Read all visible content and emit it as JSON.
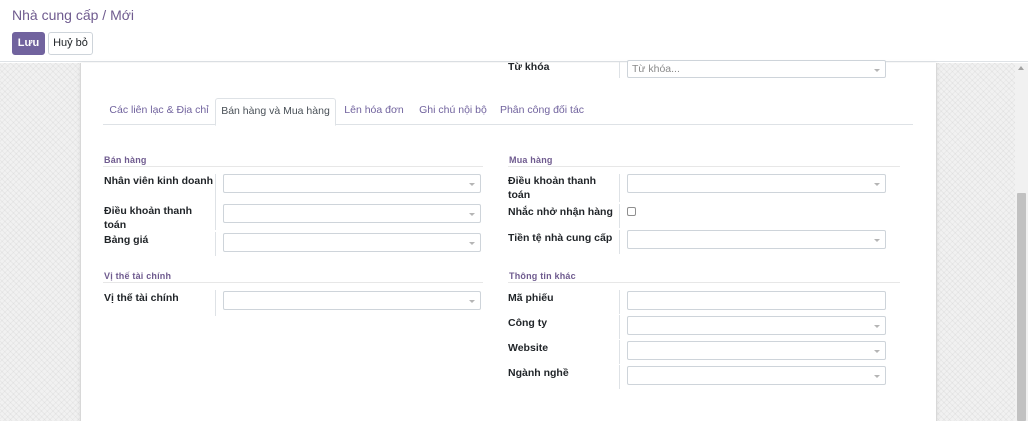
{
  "breadcrumb": {
    "parent": "Nhà cung cấp",
    "separator": " / ",
    "current": "Mới"
  },
  "actions": {
    "save_label": "Lưu",
    "discard_label": "Huỷ bỏ"
  },
  "top_field": {
    "label": "Từ khóa",
    "placeholder": "Từ khóa..."
  },
  "tabs": [
    {
      "label": "Các liên lạc & Địa chỉ"
    },
    {
      "label": "Bán hàng và Mua hàng",
      "active": true
    },
    {
      "label": "Lên hóa đơn"
    },
    {
      "label": "Ghi chú nội bộ"
    },
    {
      "label": "Phân công đối tác"
    }
  ],
  "sales": {
    "title": "Bán hàng",
    "fields": [
      {
        "label": "Nhân viên kinh doanh"
      },
      {
        "label": "Điều khoản thanh toán"
      },
      {
        "label": "Bảng giá"
      }
    ]
  },
  "purchase": {
    "title": "Mua hàng",
    "fields": [
      {
        "label": "Điều khoản thanh toán"
      },
      {
        "label": "Nhắc nhở nhận hàng"
      },
      {
        "label": "Tiền tệ nhà cung cấp"
      }
    ]
  },
  "fiscal": {
    "title": "Vị thế tài chính",
    "fields": [
      {
        "label": "Vị thế tài chính"
      }
    ]
  },
  "misc": {
    "title": "Thông tin khác",
    "fields": [
      {
        "label": "Mã phiếu"
      },
      {
        "label": "Công ty"
      },
      {
        "label": "Website"
      },
      {
        "label": "Ngành nghề"
      }
    ]
  },
  "colors": {
    "primary": "#71639e",
    "breadcrumb": "#6f5b8f"
  }
}
